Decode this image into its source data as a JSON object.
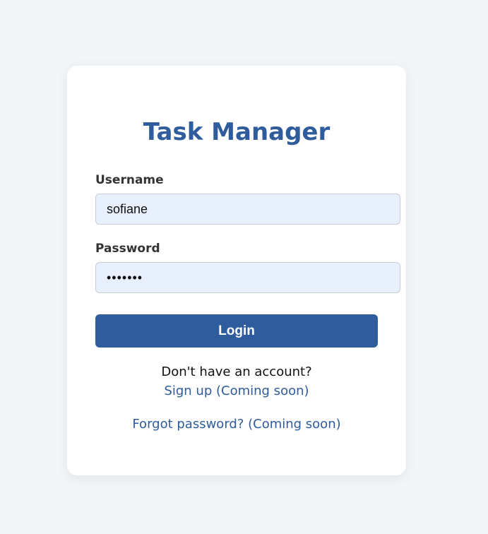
{
  "login": {
    "title": "Task Manager",
    "username_label": "Username",
    "username_value": "sofiane",
    "password_label": "Password",
    "password_masked": "•••••••",
    "login_button": "Login",
    "signup_prompt": "Don't have an account?",
    "signup_link": "Sign up (Coming soon)",
    "forgot_link": "Forgot password? (Coming soon)"
  },
  "colors": {
    "primary": "#2e5c9c",
    "input_bg": "#e8f0fe",
    "page_bg": "#f3f6f9",
    "card_bg": "#ffffff"
  }
}
